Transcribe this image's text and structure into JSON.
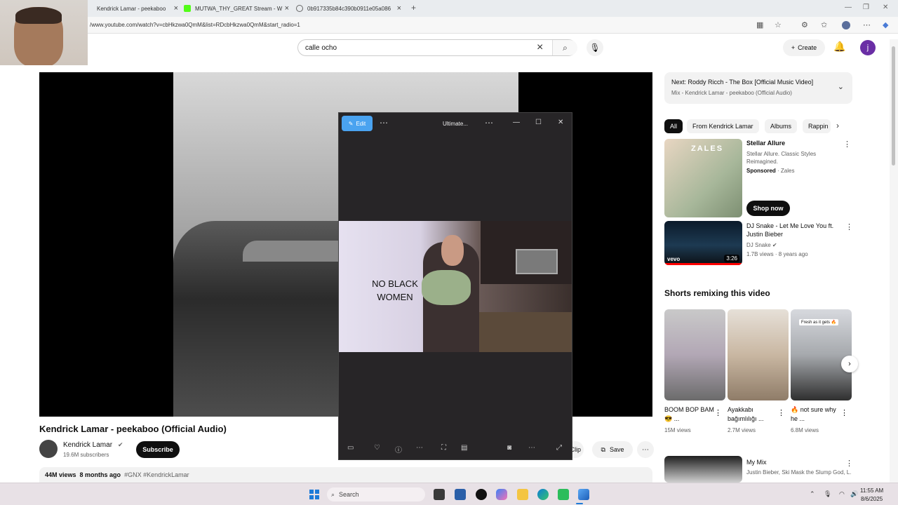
{
  "browser": {
    "tabs": [
      {
        "label": "Kendrick Lamar - peekaboo"
      },
      {
        "label": "MUTWA_THY_GREAT Stream - W"
      },
      {
        "label": "0b917335b84c390b0911e05a086"
      }
    ],
    "new_tab_label": "+",
    "url": "/www.youtube.com/watch?v=cbHkzwa0QmM&list=RDcbHkzwa0QmM&start_radio=1"
  },
  "header": {
    "search_value": "calle ocho",
    "create_label": "Create",
    "avatar_letter": "j"
  },
  "video": {
    "title": "Kendrick Lamar - peekaboo (Official Audio)",
    "channel": "Kendrick Lamar",
    "subscribers": "19.6M subscribers",
    "subscribe_label": "Subscribe",
    "clip_label": "Clip",
    "save_label": "Save",
    "views": "44M views",
    "age": "8 months ago",
    "hashtags": "#GNX #KendrickLamar"
  },
  "sidebar": {
    "next_prefix": "Next:",
    "next_title": "Roddy Ricch - The Box [Official Music Video]",
    "next_sub": "Mix - Kendrick Lamar - peekaboo (Official Audio)",
    "chips": [
      "All",
      "From Kendrick Lamar",
      "Albums",
      "Rappin"
    ],
    "ad": {
      "logo": "ZALES",
      "title": "Stellar Allure",
      "desc": "Stellar Allure. Classic Styles Reimagined.",
      "sponsored": "Sponsored",
      "brand": "Zales",
      "cta": "Shop now"
    },
    "video1": {
      "title": "DJ Snake - Let Me Love You ft. Justin Bieber",
      "channel": "DJ Snake",
      "meta": "1.7B views · 8 years ago",
      "duration": "3:26",
      "vevo": "vevo"
    },
    "shorts_heading": "Shorts remixing this video",
    "shorts": [
      {
        "title": "BOOM BOP BAM 😎 ...",
        "views": "15M views"
      },
      {
        "title": "Ayakkabı bağımlılığı ...",
        "views": "2.7M views"
      },
      {
        "title": "🔥 not sure why he ...",
        "views": "6.8M views"
      }
    ],
    "short3_caption": "Fresh as it gets 🔥",
    "mix": {
      "title": "My Mix",
      "desc": "Justin Bieber, Ski Mask the Slump God, L..."
    }
  },
  "photos_app": {
    "edit_label": "Edit",
    "title": "Ultimate...",
    "caption": "NO BLACK WOMEN"
  },
  "taskbar": {
    "search_label": "Search",
    "time": "11:55 AM",
    "date": "8/6/2025"
  }
}
